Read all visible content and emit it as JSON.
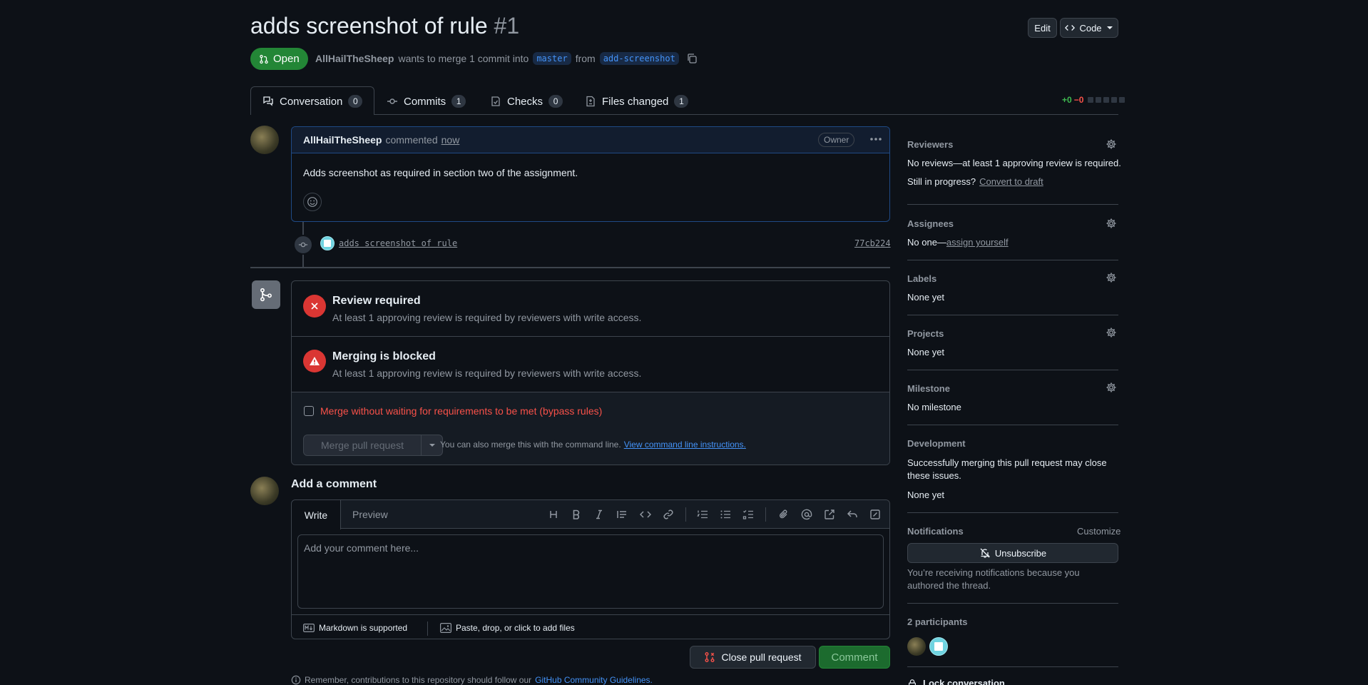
{
  "pr": {
    "title": "adds screenshot of rule",
    "number": "#1",
    "status": "Open",
    "author": "AllHailTheSheep",
    "merge_text_1": "wants to merge 1 commit into",
    "base_branch": "master",
    "merge_text_2": "from",
    "head_branch": "add-screenshot"
  },
  "header_actions": {
    "edit": "Edit",
    "code": "Code"
  },
  "tabs": [
    {
      "label": "Conversation",
      "count": "0"
    },
    {
      "label": "Commits",
      "count": "1"
    },
    {
      "label": "Checks",
      "count": "0"
    },
    {
      "label": "Files changed",
      "count": "1"
    }
  ],
  "diffstat": {
    "additions": "+0",
    "deletions": "−0"
  },
  "comment": {
    "author": "AllHailTheSheep",
    "action": "commented",
    "time": "now",
    "role": "Owner",
    "body": "Adds screenshot as required in section two of the assignment."
  },
  "commit": {
    "message": "adds screenshot of rule",
    "sha": "77cb224"
  },
  "merge_box": {
    "review_title": "Review required",
    "review_desc": "At least 1 approving review is required by reviewers with write access.",
    "blocked_title": "Merging is blocked",
    "blocked_desc": "At least 1 approving review is required by reviewers with write access.",
    "bypass_label": "Merge without waiting for requirements to be met (bypass rules)",
    "merge_button": "Merge pull request",
    "cli_text": "You can also merge this with the command line.",
    "cli_link": "View command line instructions."
  },
  "add_comment": {
    "heading": "Add a comment",
    "tab_write": "Write",
    "tab_preview": "Preview",
    "placeholder": "Add your comment here...",
    "markdown_note": "Markdown is supported",
    "files_note": "Paste, drop, or click to add files",
    "close_button": "Close pull request",
    "comment_button": "Comment",
    "guidelines_text": "Remember, contributions to this repository should follow our",
    "guidelines_link": "GitHub Community Guidelines."
  },
  "toolbar_icons": [
    "heading-icon",
    "bold-icon",
    "italic-icon",
    "quote-icon",
    "code-icon",
    "link-icon",
    "numbered-list-icon",
    "bulleted-list-icon",
    "task-list-icon",
    "attach-icon",
    "mention-icon",
    "cross-reference-icon",
    "saved-reply-icon",
    "fullscreen-icon"
  ],
  "sidebar": {
    "reviewers": {
      "heading": "Reviewers",
      "text": "No reviews—at least 1 approving review is required.",
      "progress": "Still in progress?",
      "draft_link": "Convert to draft"
    },
    "assignees": {
      "heading": "Assignees",
      "text": "No one—",
      "link": "assign yourself"
    },
    "labels": {
      "heading": "Labels",
      "value": "None yet"
    },
    "projects": {
      "heading": "Projects",
      "value": "None yet"
    },
    "milestone": {
      "heading": "Milestone",
      "value": "No milestone"
    },
    "development": {
      "heading": "Development",
      "text": "Successfully merging this pull request may close these issues.",
      "value": "None yet"
    },
    "notifications": {
      "heading": "Notifications",
      "customize": "Customize",
      "button": "Unsubscribe",
      "text": "You’re receiving notifications because you authored the thread."
    },
    "participants": {
      "heading": "2 participants"
    },
    "lock": "Lock conversation"
  },
  "colors": {
    "open_green": "#238636",
    "danger": "#da3633",
    "accent": "#4493f8",
    "background": "#0d1117"
  }
}
